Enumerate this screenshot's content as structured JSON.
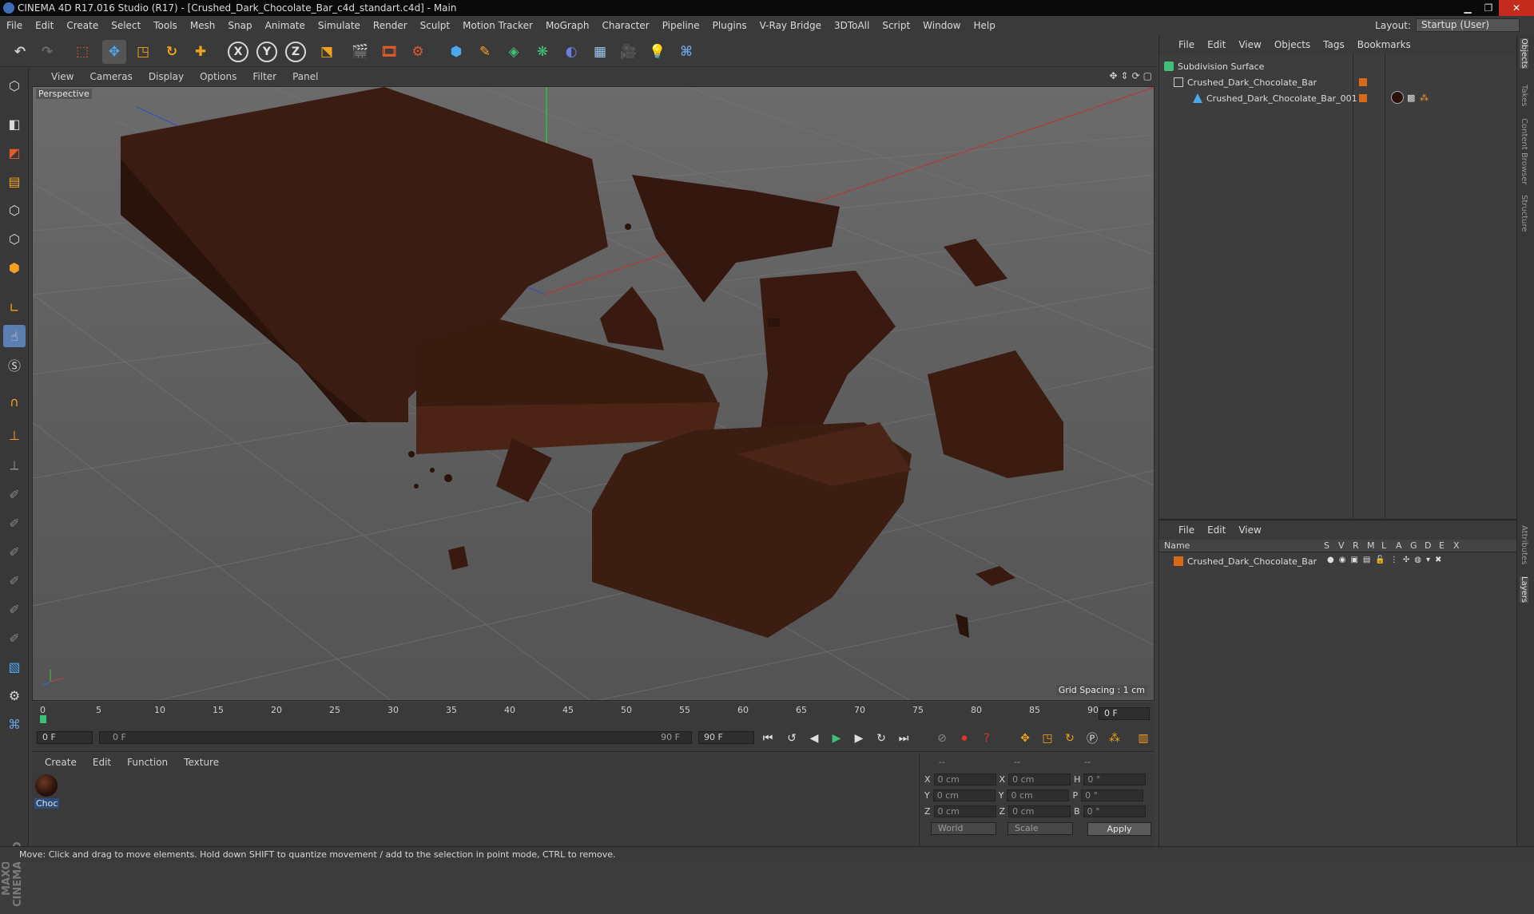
{
  "window": {
    "title": "CINEMA 4D R17.016 Studio (R17) - [Crushed_Dark_Chocolate_Bar_c4d_standart.c4d] - Main"
  },
  "menu": [
    "File",
    "Edit",
    "Create",
    "Select",
    "Tools",
    "Mesh",
    "Snap",
    "Animate",
    "Simulate",
    "Render",
    "Sculpt",
    "Motion Tracker",
    "MoGraph",
    "Character",
    "Pipeline",
    "Plugins",
    "V-Ray Bridge",
    "3DToAll",
    "Script",
    "Window",
    "Help"
  ],
  "layout": {
    "label": "Layout:",
    "value": "Startup (User)"
  },
  "toolbar": {
    "x": "X",
    "y": "Y",
    "z": "Z"
  },
  "viewport": {
    "menu": [
      "View",
      "Cameras",
      "Display",
      "Options",
      "Filter",
      "Panel"
    ],
    "label": "Perspective",
    "grid_spacing": "Grid Spacing : 1 cm"
  },
  "timeline": {
    "ticks": [
      "0",
      "5",
      "10",
      "15",
      "20",
      "25",
      "30",
      "35",
      "40",
      "45",
      "50",
      "55",
      "60",
      "65",
      "70",
      "75",
      "80",
      "85",
      "90"
    ],
    "current": "0 F"
  },
  "transport": {
    "start": "0 F",
    "range_start": "0 F",
    "range_end": "90 F",
    "end": "90 F"
  },
  "material": {
    "menu": [
      "Create",
      "Edit",
      "Function",
      "Texture"
    ],
    "name": "Choc"
  },
  "coords": {
    "headers": [
      "--",
      "--",
      "--"
    ],
    "rows": [
      {
        "a": "X",
        "av": "0 cm",
        "b": "X",
        "bv": "0 cm",
        "c": "H",
        "cv": "0 °"
      },
      {
        "a": "Y",
        "av": "0 cm",
        "b": "Y",
        "bv": "0 cm",
        "c": "P",
        "cv": "0 °"
      },
      {
        "a": "Z",
        "av": "0 cm",
        "b": "Z",
        "bv": "0 cm",
        "c": "B",
        "cv": "0 °"
      }
    ],
    "space": "World",
    "mode": "Scale",
    "apply": "Apply"
  },
  "objects": {
    "menu": [
      "File",
      "Edit",
      "View",
      "Objects",
      "Tags",
      "Bookmarks"
    ],
    "items": [
      "Subdivision Surface",
      "Crushed_Dark_Chocolate_Bar",
      "Crushed_Dark_Chocolate_Bar_001"
    ]
  },
  "layers": {
    "menu": [
      "File",
      "Edit",
      "View"
    ],
    "columns": {
      "name": "Name",
      "flags": [
        "S",
        "V",
        "R",
        "M",
        "L",
        "A",
        "G",
        "D",
        "E",
        "X"
      ]
    },
    "items": [
      "Crushed_Dark_Chocolate_Bar"
    ]
  },
  "right_tabs": [
    "Objects",
    "Takes",
    "Content Browser",
    "Structure",
    "Attributes",
    "Layers"
  ],
  "status": "Move: Click and drag to move elements. Hold down SHIFT to quantize movement / add to the selection in point mode, CTRL to remove.",
  "colors": {
    "accent": "#5b7fb0",
    "chocolate": "#3a1c12",
    "layer_tag": "#d96a1a"
  }
}
